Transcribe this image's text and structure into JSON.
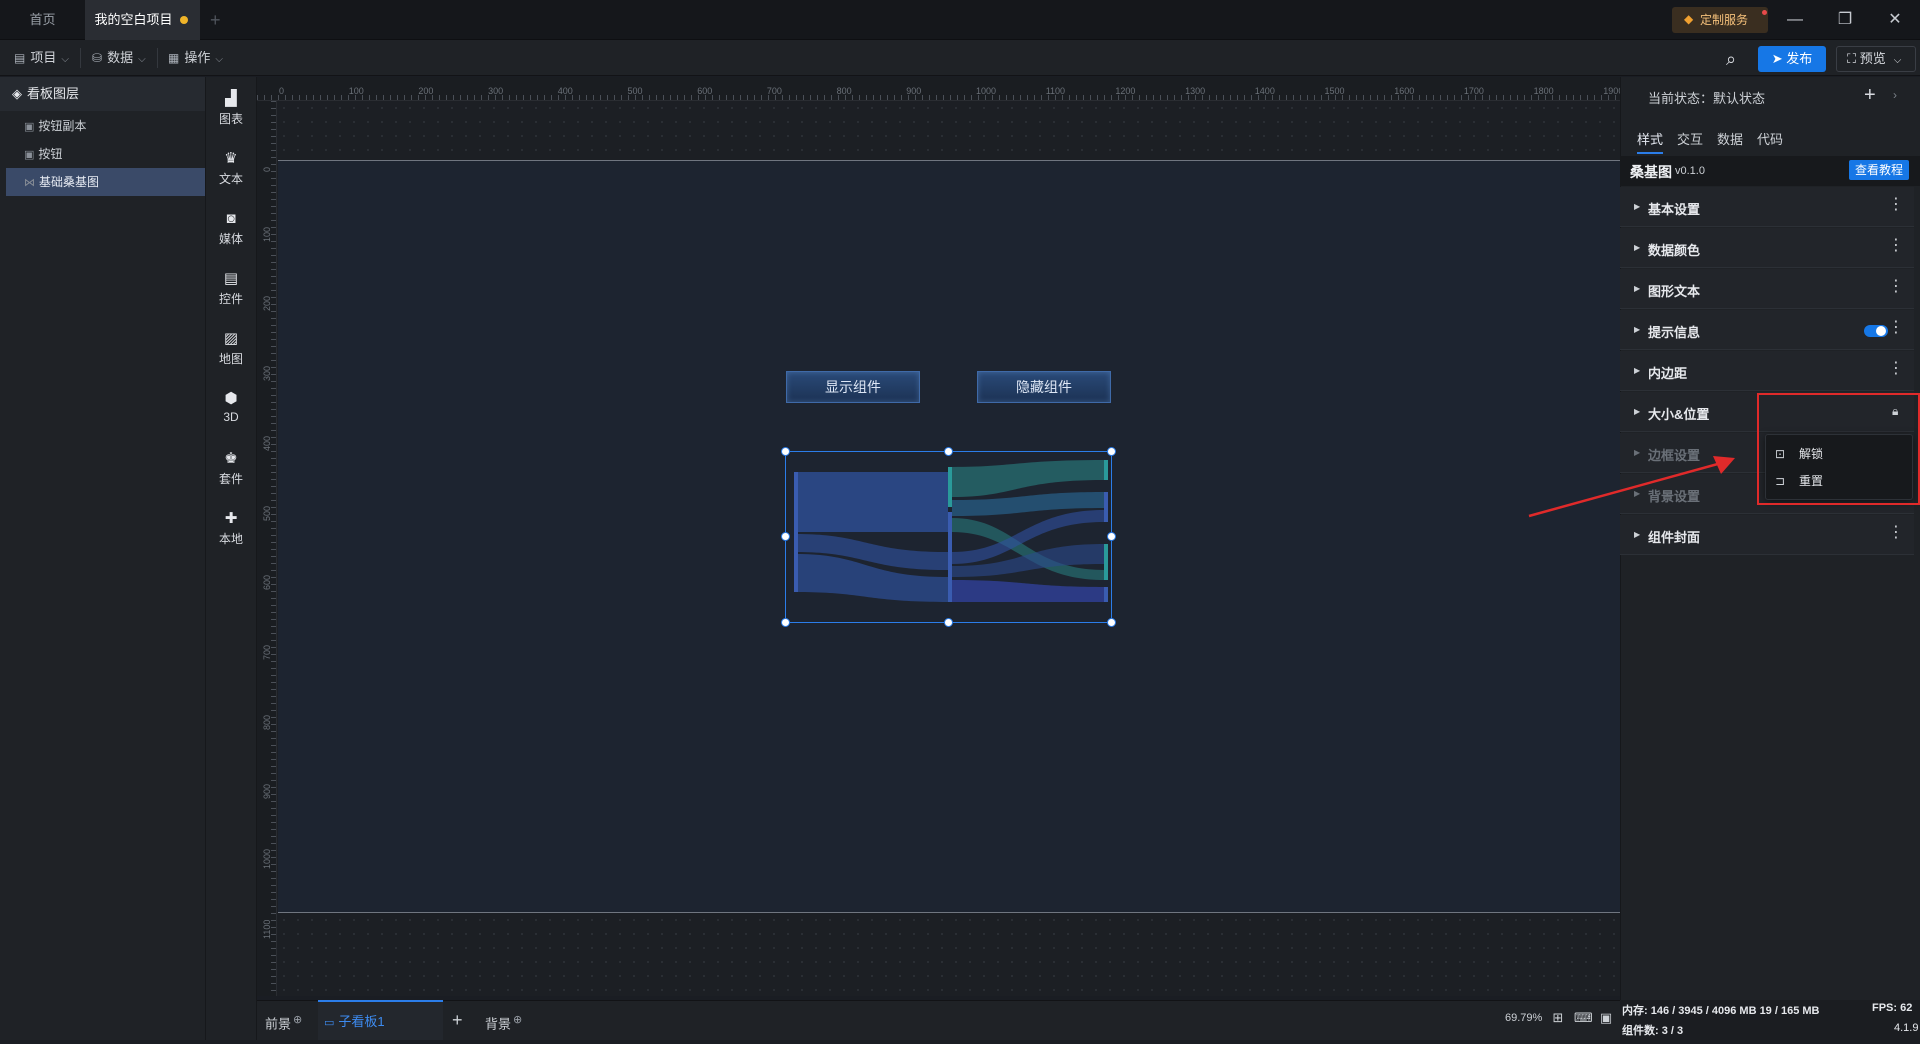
{
  "tabs": {
    "home": "首页",
    "project": "我的空白项目",
    "add": "+"
  },
  "titlebar": {
    "custom_service": "定制服务",
    "minimize": "—",
    "restore": "❐",
    "close": "✕"
  },
  "toolbar": {
    "menus": [
      {
        "label": "项目",
        "icon": "file-icon"
      },
      {
        "label": "数据",
        "icon": "database-icon"
      },
      {
        "label": "操作",
        "icon": "grid-icon"
      }
    ],
    "publish": "发布",
    "preview": "预览"
  },
  "layers": {
    "title": "看板图层",
    "items": [
      {
        "label": "按钮副本"
      },
      {
        "label": "按钮"
      },
      {
        "label": "基础桑基图"
      }
    ]
  },
  "components": [
    "图表",
    "文本",
    "媒体",
    "控件",
    "地图",
    "3D",
    "套件",
    "本地"
  ],
  "ruler": {
    "top": [
      "0",
      "100",
      "200",
      "300",
      "400",
      "500",
      "600",
      "700",
      "800",
      "900",
      "1000",
      "1100",
      "1200",
      "1300",
      "1400",
      "1500",
      "1600",
      "1700",
      "1800",
      "1900"
    ],
    "left": [
      "0",
      "100",
      "200",
      "300",
      "400",
      "500",
      "600",
      "700",
      "800",
      "900",
      "1000",
      "1100"
    ]
  },
  "canvas": {
    "show_button": "显示组件",
    "hide_button": "隐藏组件"
  },
  "bottom": {
    "foreground": "前景",
    "subboard": "子看板1",
    "add": "+",
    "background": "背景",
    "zoom": "69.79%"
  },
  "panel": {
    "state_label": "当前状态：默认状态",
    "tabs": [
      "样式",
      "交互",
      "数据",
      "代码"
    ],
    "component_name": "桑基图",
    "component_version": "v0.1.0",
    "tutorial": "查看教程",
    "sections": [
      {
        "label": "基本设置"
      },
      {
        "label": "数据颜色"
      },
      {
        "label": "图形文本"
      },
      {
        "label": "提示信息"
      },
      {
        "label": "内边距"
      },
      {
        "label": "大小&位置"
      },
      {
        "label": "边框设置"
      },
      {
        "label": "背景设置"
      },
      {
        "label": "组件封面"
      }
    ],
    "context_menu": [
      {
        "label": "解锁",
        "icon": "unlock-icon"
      },
      {
        "label": "重置",
        "icon": "reset-icon"
      }
    ]
  },
  "status": {
    "memory": "内存:  146 / 3945 / 4096 MB  19 / 165 MB",
    "fps": "FPS:  62",
    "count": "组件数: 3 / 3",
    "version": "4.1.9"
  },
  "colors": {
    "accent": "#1677e6",
    "highlight": "#e02a2a",
    "sankey_blue": "#2c4a8c",
    "sankey_teal": "#2a8a8a"
  }
}
